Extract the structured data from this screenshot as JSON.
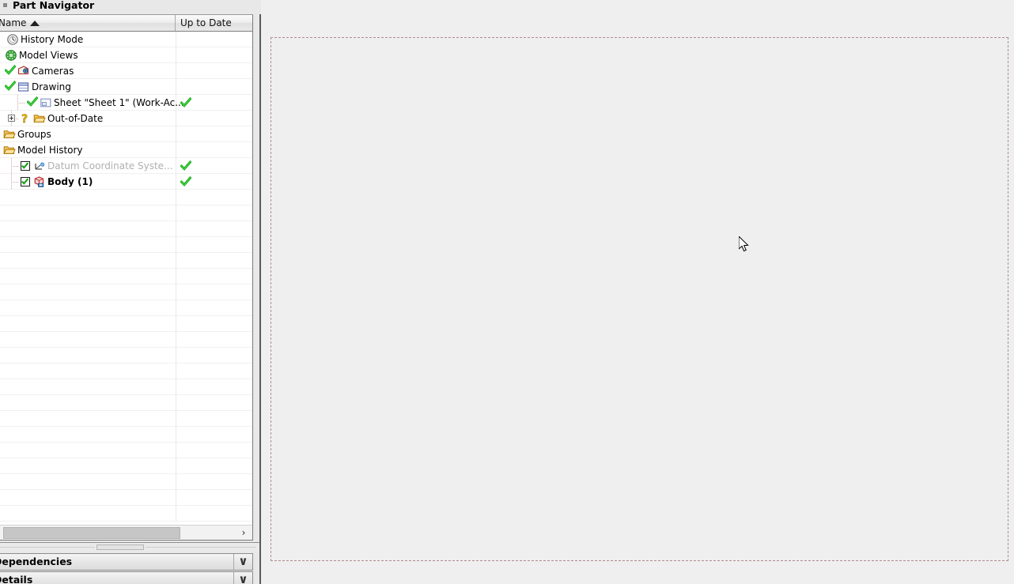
{
  "panel": {
    "title": "Part Navigator",
    "columns": [
      {
        "label": "Name",
        "sort": "ascending"
      },
      {
        "label": "Up to Date"
      }
    ],
    "rows": [
      {
        "label": "History Mode",
        "icon": "clock-icon",
        "indent": 8,
        "check": false,
        "status": "",
        "style": "normal",
        "expander": false,
        "mark": ""
      },
      {
        "label": "Model Views",
        "icon": "model-views-icon",
        "indent": 6,
        "check": false,
        "status": "",
        "style": "normal",
        "expander": false,
        "mark": ""
      },
      {
        "label": "Cameras",
        "icon": "camera-icon",
        "indent": 22,
        "check": false,
        "status": "",
        "style": "normal",
        "expander": false,
        "mark": "check"
      },
      {
        "label": "Drawing",
        "icon": "drawing-icon",
        "indent": 22,
        "check": false,
        "status": "",
        "style": "normal",
        "expander": false,
        "mark": "check"
      },
      {
        "label": "Sheet \"Sheet 1\" (Work-Ac...",
        "icon": "sheet-icon",
        "indent": 50,
        "check": false,
        "status": "up-to-date",
        "style": "normal",
        "expander": false,
        "mark": "check"
      },
      {
        "label": "Out-of-Date",
        "icon": "folder-icon",
        "indent": 42,
        "check": false,
        "status": "",
        "style": "normal",
        "expander": true,
        "mark": "question"
      },
      {
        "label": "Groups",
        "icon": "folder-icon",
        "indent": 4,
        "check": false,
        "status": "",
        "style": "normal",
        "expander": false,
        "mark": ""
      },
      {
        "label": "Model History",
        "icon": "folder-icon",
        "indent": 4,
        "check": false,
        "status": "",
        "style": "normal",
        "expander": false,
        "mark": ""
      },
      {
        "label": "Datum Coordinate Syste...",
        "icon": "datum-csys-icon",
        "indent": 42,
        "check": true,
        "status": "up-to-date",
        "style": "greyed",
        "expander": false,
        "mark": ""
      },
      {
        "label": "Body (1)",
        "icon": "body-icon",
        "indent": 42,
        "check": true,
        "status": "up-to-date",
        "style": "bold",
        "expander": false,
        "mark": ""
      }
    ],
    "empty_row_count": 21,
    "scrollbar": {
      "right_arrow": "›"
    },
    "sections": [
      {
        "label": "Dependencies",
        "chevron": "∨",
        "expanded": false
      },
      {
        "label": "Details",
        "chevron": "∨",
        "expanded": false
      }
    ]
  },
  "canvas": {
    "sheet_border_style": "dashed",
    "sheet_border_color": "#b08a8f",
    "background_color": "#efefef",
    "cursor": "arrow-pointer"
  }
}
